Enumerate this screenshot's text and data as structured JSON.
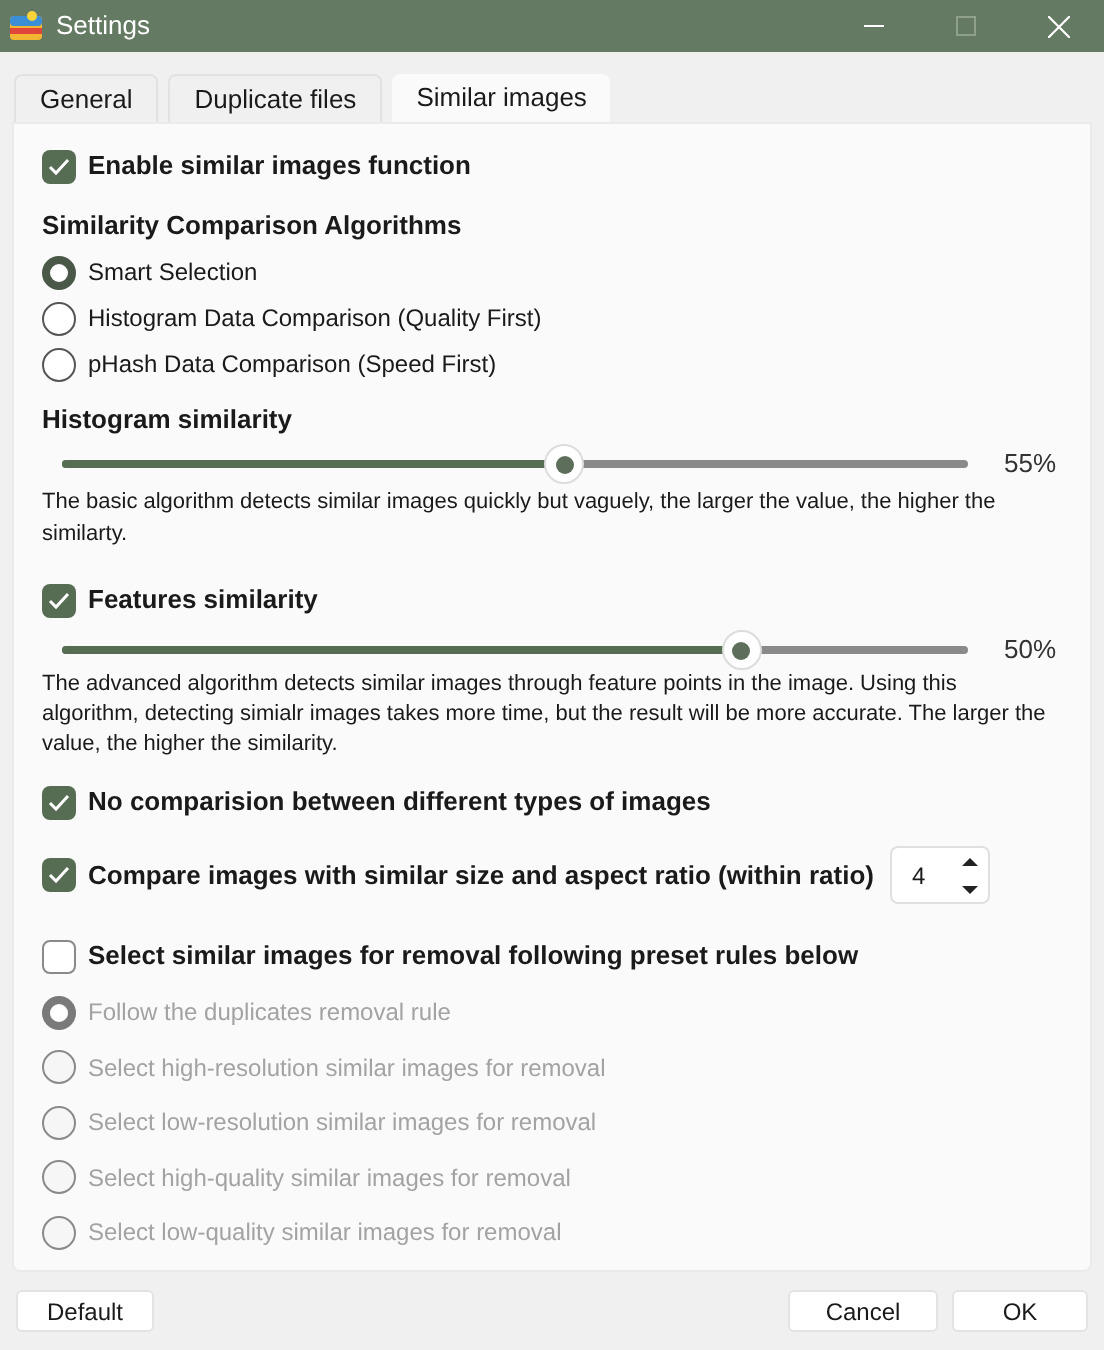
{
  "window": {
    "title": "Settings",
    "controls": [
      {
        "kind": "minimize",
        "disabled": false
      },
      {
        "kind": "maximize",
        "disabled": true
      },
      {
        "kind": "close",
        "disabled": false
      }
    ]
  },
  "tabs": [
    {
      "label": "General",
      "selected": false
    },
    {
      "label": "Duplicate files",
      "selected": false
    },
    {
      "label": "Similar images",
      "selected": true
    }
  ],
  "enable": {
    "label": "Enable similar images function",
    "checked": true
  },
  "algorithms": {
    "heading": "Similarity Comparison Algorithms",
    "options": [
      {
        "label": "Smart Selection",
        "selected": true
      },
      {
        "label": "Histogram Data Comparison (Quality First)",
        "selected": false
      },
      {
        "label": "pHash Data Comparison (Speed First)",
        "selected": false
      }
    ]
  },
  "histogram": {
    "heading": "Histogram similarity",
    "level": 0.555,
    "reading": "55%",
    "description": "The basic algorithm detects similar images quickly but vaguely, the larger the value, the higher the similarty."
  },
  "features": {
    "label": "Features similarity",
    "checked": true,
    "level": 0.75,
    "reading": "50%",
    "description": "The advanced algorithm detects similar images through feature points in the image. Using this algorithm, detecting simialr images takes more time, but the result will be more accurate. The larger the value, the higher the similarity."
  },
  "comparisons": [
    {
      "label": "No comparision between different types of images",
      "checked": true
    },
    {
      "label": "Compare images with similar size and aspect ratio (within ratio)",
      "checked": true,
      "ratio": "4"
    }
  ],
  "removal": {
    "label": "Select similar images for removal following preset rules below",
    "checked": false,
    "options": [
      {
        "label": "Follow the duplicates removal rule",
        "selected": true,
        "disabled": true
      },
      {
        "label": "Select high-resolution similar images for removal",
        "selected": false,
        "disabled": true
      },
      {
        "label": "Select low-resolution similar images for removal",
        "selected": false,
        "disabled": true
      },
      {
        "label": "Select high-quality similar images for removal",
        "selected": false,
        "disabled": true
      },
      {
        "label": "Select low-quality similar images for removal",
        "selected": false,
        "disabled": true
      }
    ]
  },
  "buttons": [
    {
      "label": "Default"
    },
    {
      "label": "Cancel"
    },
    {
      "label": "OK"
    }
  ]
}
